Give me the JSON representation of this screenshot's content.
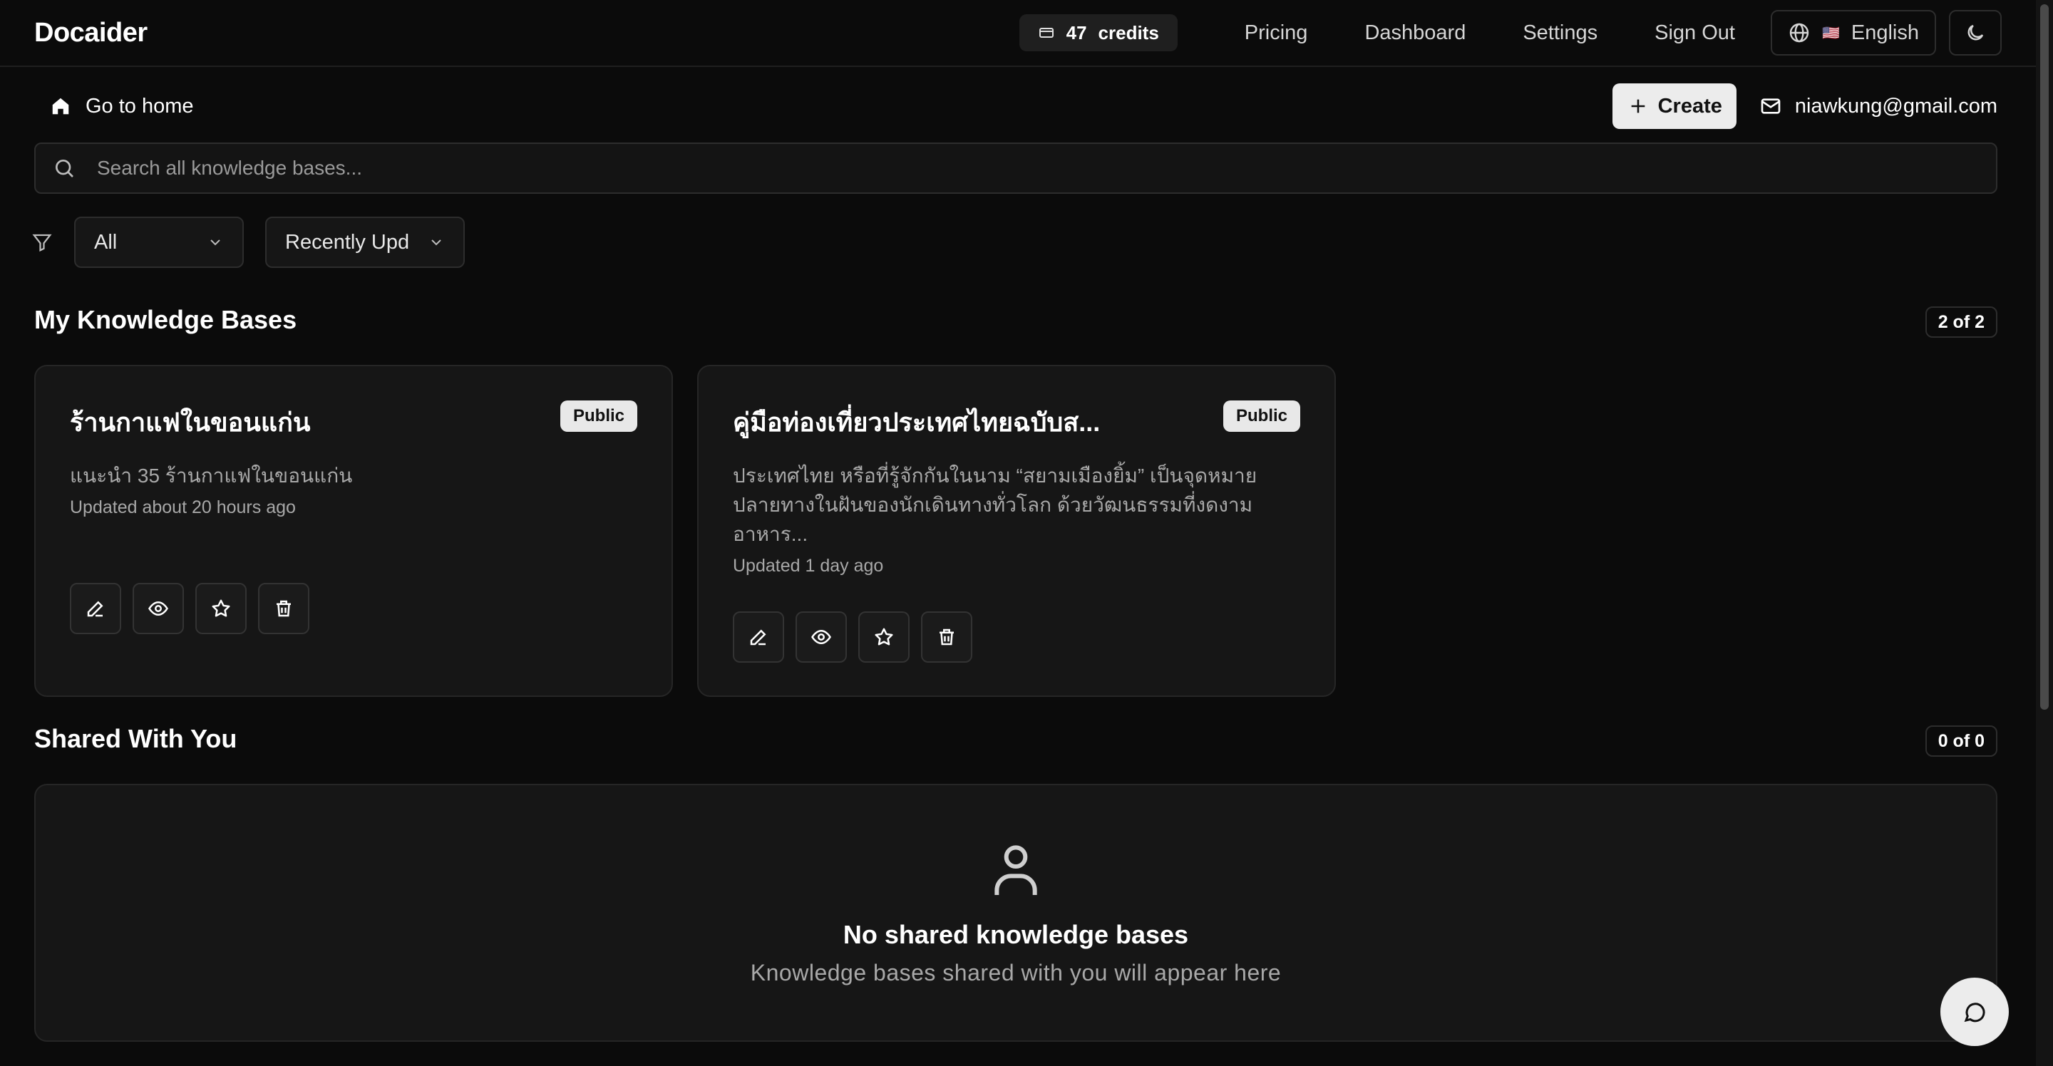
{
  "header": {
    "brand": "Docaider",
    "credits_count": "47",
    "credits_label": "credits",
    "nav": [
      "Pricing",
      "Dashboard",
      "Settings",
      "Sign Out"
    ],
    "language": "English",
    "language_flag": "🇺🇸"
  },
  "toolbar": {
    "home_label": "Go to home",
    "create_label": "Create",
    "email": "niawkung@gmail.com"
  },
  "search": {
    "placeholder": "Search all knowledge bases..."
  },
  "filters": {
    "visibility": "All",
    "sort": "Recently Upd"
  },
  "my_kb": {
    "title": "My Knowledge Bases",
    "count": "2 of 2",
    "cards": [
      {
        "title": "ร้านกาแฟในขอนแก่น",
        "badge": "Public",
        "description": "แนะนำ 35 ร้านกาแฟในขอนแก่น",
        "updated": "Updated about 20 hours ago"
      },
      {
        "title": "คู่มือท่องเที่ยวประเทศไทยฉบับส...",
        "badge": "Public",
        "description": "ประเทศไทย หรือที่รู้จักกันในนาม “สยามเมืองยิ้ม” เป็นจุดหมายปลายทางในฝันของนักเดินทางทั่วโลก ด้วยวัฒนธรรมที่งดงาม อาหาร...",
        "updated": "Updated 1 day ago"
      }
    ]
  },
  "shared": {
    "title": "Shared With You",
    "count": "0 of 0",
    "empty_title": "No shared knowledge bases",
    "empty_subtitle": "Knowledge bases shared with you will appear here"
  },
  "colors": {
    "background": "#0b0b0b",
    "card": "#161616",
    "border": "#2d2d2d",
    "muted_text": "#a8a8a8",
    "badge_bg": "#e8e8e8"
  }
}
